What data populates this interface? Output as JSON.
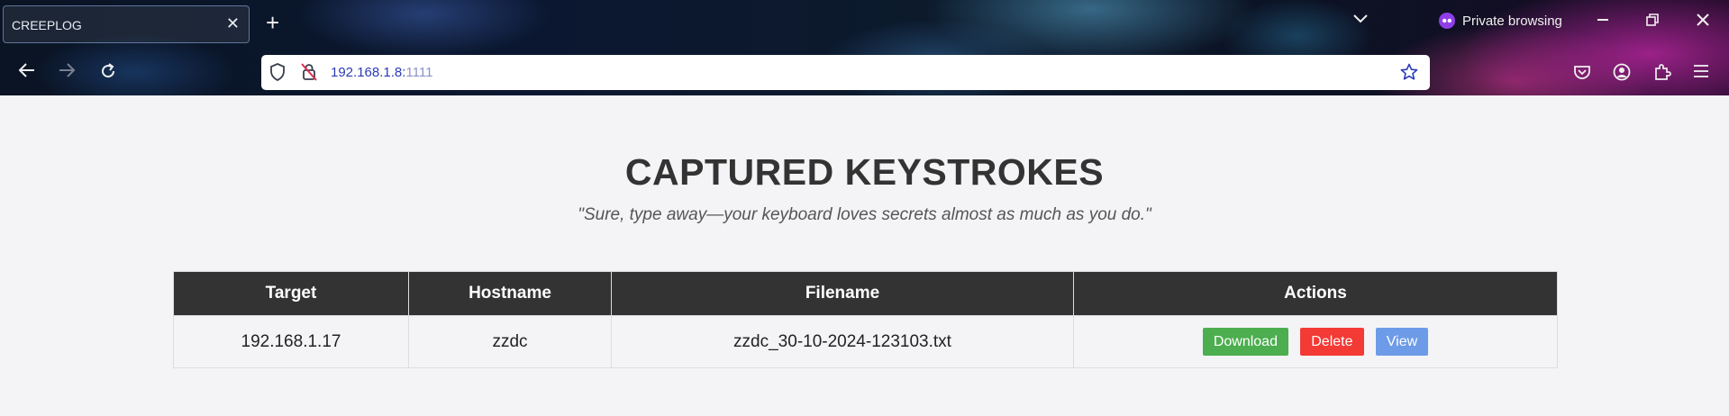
{
  "browser": {
    "tab_title": "CREEPLOG",
    "url_host": "192.168.1.8:",
    "url_port": "1111",
    "private_label": "Private browsing",
    "icons": {
      "tab_close": "close-icon",
      "new_tab": "plus-icon",
      "tab_list": "chevron-down-icon",
      "private": "mask-icon",
      "minimize": "minimize-icon",
      "restore": "restore-icon",
      "close": "close-icon",
      "back": "back-arrow-icon",
      "forward": "forward-arrow-icon",
      "reload": "reload-icon",
      "shield": "shield-icon",
      "insecure_lock": "lock-slash-icon",
      "bookmark": "star-icon",
      "pocket": "pocket-icon",
      "account": "account-icon",
      "extensions": "puzzle-icon",
      "menu": "hamburger-menu-icon"
    }
  },
  "page": {
    "title": "CAPTURED KEYSTROKES",
    "subtitle": "\"Sure, type away—your keyboard loves secrets almost as much as you do.\""
  },
  "table": {
    "headers": [
      "Target",
      "Hostname",
      "Filename",
      "Actions"
    ],
    "rows": [
      {
        "target": "192.168.1.17",
        "hostname": "zzdc",
        "filename": "zzdc_30-10-2024-123103.txt",
        "actions": {
          "download": "Download",
          "delete": "Delete",
          "view": "View"
        }
      }
    ]
  },
  "colors": {
    "download": "#4cae4f",
    "delete": "#f33a35",
    "view": "#6d9be8",
    "header_bg": "#333333",
    "page_bg": "#f4f4f7"
  }
}
